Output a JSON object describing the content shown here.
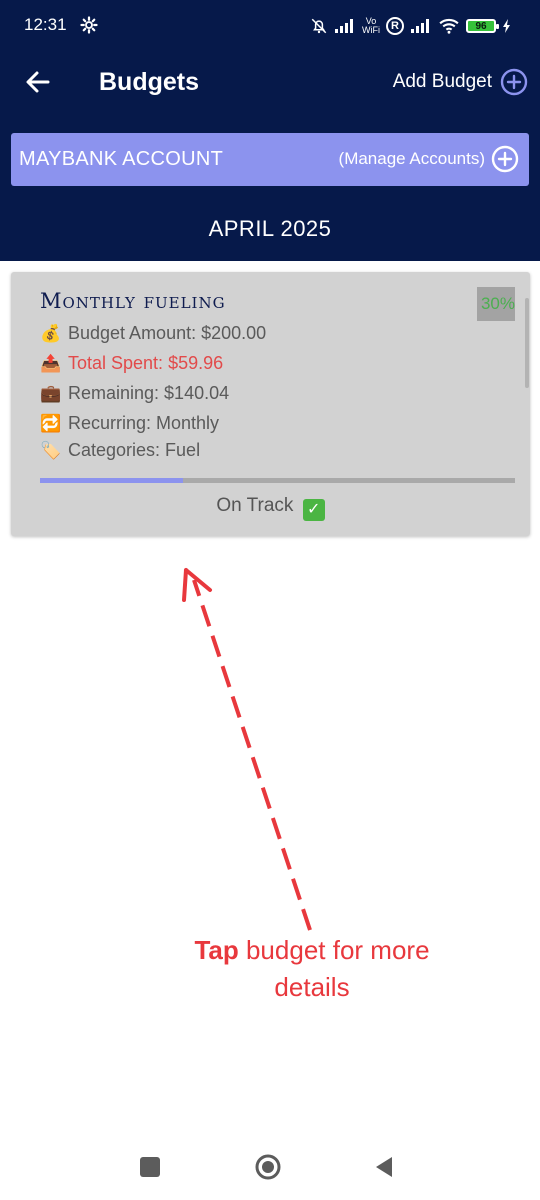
{
  "status_bar": {
    "time": "12:31",
    "vowifi_top": "Vo",
    "vowifi_bottom": "WiFi",
    "roaming": "R",
    "battery": "96"
  },
  "app_bar": {
    "title": "Budgets",
    "add_budget_label": "Add Budget"
  },
  "account": {
    "name": "MAYBANK ACCOUNT",
    "manage_label": "(Manage Accounts)"
  },
  "period": "APRIL 2025",
  "budget_card": {
    "title": "Monthly fueling",
    "percent_label": "30%",
    "budget_amount": "Budget Amount: $200.00",
    "total_spent": "Total Spent: $59.96",
    "remaining": "Remaining: $140.04",
    "recurring": "Recurring: Monthly",
    "categories": "Categories: Fuel",
    "progress_fraction": 0.3,
    "status": "On Track",
    "icons": [
      "money-bag-icon",
      "outbox-tray-icon",
      "briefcase-icon",
      "repeat-icon",
      "label-tag-icon",
      "check-mark-icon"
    ]
  },
  "annotation": {
    "bold": "Tap",
    "rest": " budget for more details"
  },
  "colors": {
    "header_bg": "#06194a",
    "account_bg": "#8c93ee",
    "card_bg": "#d2d2d2",
    "spent_red": "#e24a4a",
    "percent_green": "#4caf50",
    "annotation_red": "#e8383d"
  }
}
